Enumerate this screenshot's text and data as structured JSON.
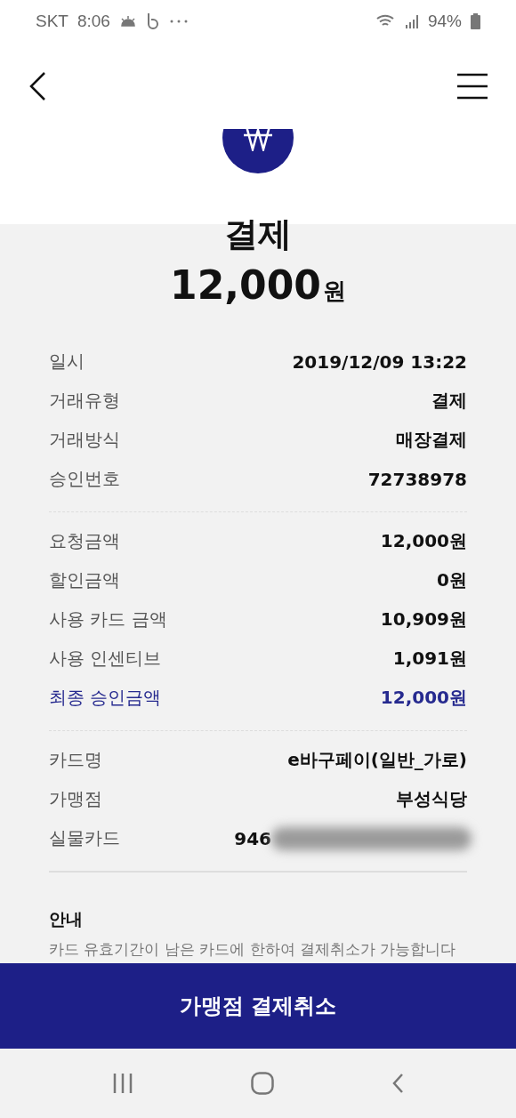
{
  "status_bar": {
    "carrier": "SKT",
    "time": "8:06",
    "battery": "94%"
  },
  "summary": {
    "title": "결제",
    "amount": "12,000",
    "currency": "원"
  },
  "sections": [
    {
      "rows": [
        {
          "label": "일시",
          "value": "2019/12/09 13:22",
          "highlighted": false,
          "redacted": false
        },
        {
          "label": "거래유형",
          "value": "결제",
          "highlighted": false,
          "redacted": false
        },
        {
          "label": "거래방식",
          "value": "매장결제",
          "highlighted": false,
          "redacted": false
        },
        {
          "label": "승인번호",
          "value": "72738978",
          "highlighted": false,
          "redacted": false
        }
      ]
    },
    {
      "rows": [
        {
          "label": "요청금액",
          "value": "12,000원",
          "highlighted": false,
          "redacted": false
        },
        {
          "label": "할인금액",
          "value": "0원",
          "highlighted": false,
          "redacted": false
        },
        {
          "label": "사용 카드 금액",
          "value": "10,909원",
          "highlighted": false,
          "redacted": false
        },
        {
          "label": "사용 인센티브",
          "value": "1,091원",
          "highlighted": false,
          "redacted": false
        },
        {
          "label": "최종 승인금액",
          "value": "12,000원",
          "highlighted": true,
          "redacted": false
        }
      ]
    },
    {
      "rows": [
        {
          "label": "카드명",
          "value": "e바구페이(일반_가로)",
          "highlighted": false,
          "redacted": false
        },
        {
          "label": "가맹점",
          "value": "부성식당",
          "highlighted": false,
          "redacted": false
        },
        {
          "label": "실물카드",
          "value": "946",
          "highlighted": false,
          "redacted": true
        }
      ]
    }
  ],
  "notice": {
    "title": "안내",
    "text": "카드 유효기간이 남은 카드에 한하여 결제취소가 가능합니다"
  },
  "action_button": {
    "label": "가맹점 결제취소"
  }
}
